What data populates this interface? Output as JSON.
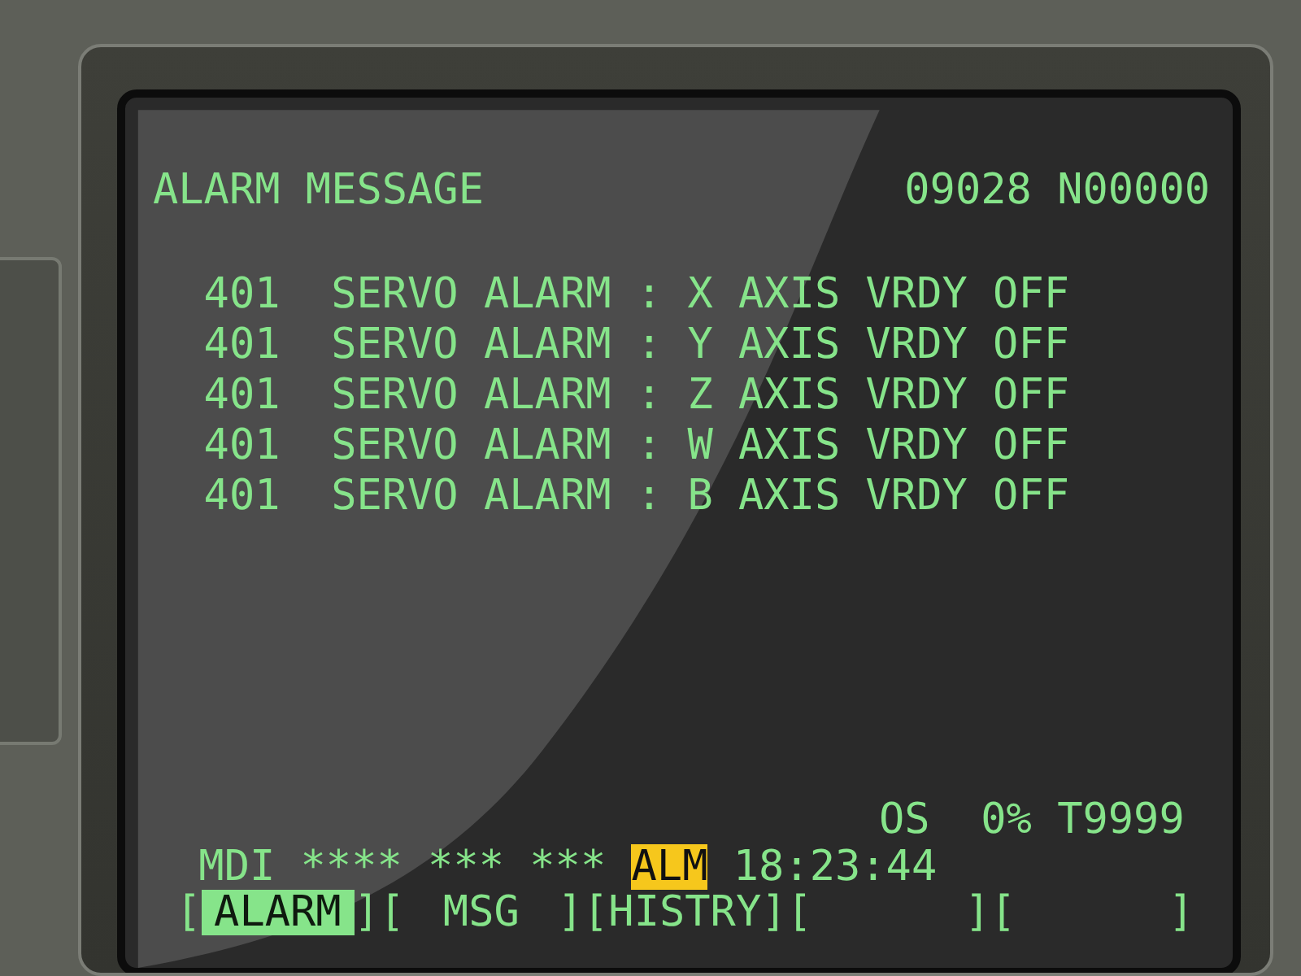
{
  "screen": {
    "title": "ALARM MESSAGE",
    "program": "09028",
    "sequence": "N00000",
    "alarms": [
      {
        "code": "401",
        "message": "SERVO ALARM : X AXIS VRDY OFF"
      },
      {
        "code": "401",
        "message": "SERVO ALARM : Y AXIS VRDY OFF"
      },
      {
        "code": "401",
        "message": "SERVO ALARM : Z AXIS VRDY OFF"
      },
      {
        "code": "401",
        "message": "SERVO ALARM : W AXIS VRDY OFF"
      },
      {
        "code": "401",
        "message": "SERVO ALARM : B AXIS VRDY OFF"
      }
    ],
    "status": {
      "override_label": "OS",
      "override": "0%",
      "tool": "T9999",
      "mode": "MDI",
      "fields": [
        "****",
        "***",
        "***"
      ],
      "alarm_badge": "ALM",
      "time": "18:23:44"
    },
    "softkeys": [
      {
        "left": "[",
        "label": "ALARM",
        "right": "]",
        "selected": true
      },
      {
        "left": "[",
        "label": "MSG",
        "right": "]",
        "selected": false
      },
      {
        "left": "[",
        "label": "HISTRY",
        "right": "]",
        "selected": false
      },
      {
        "left": "[",
        "right": "]",
        "selected": false
      },
      {
        "left": "[",
        "right": "]",
        "selected": false
      }
    ]
  }
}
